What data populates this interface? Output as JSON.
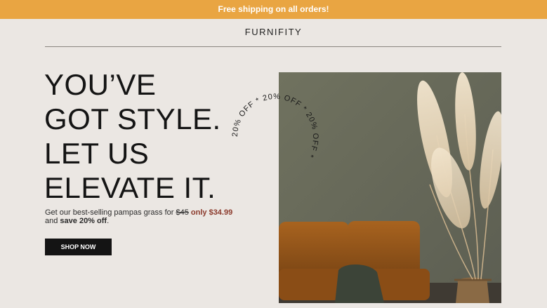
{
  "banner": {
    "text": "Free shipping on all orders!"
  },
  "brand": {
    "logo": "FURNIFITY"
  },
  "hero": {
    "headline_lines": [
      "YOU’VE",
      "GOT STYLE.",
      "LET US",
      "ELEVATE IT."
    ],
    "promo": {
      "prefix": "Get our best-selling pampas grass for ",
      "old_price": "$45",
      "new_price": "only $34.99",
      "line2_prefix": "and ",
      "save_text": "save 20% off",
      "suffix": "."
    },
    "cta_label": "SHOP NOW",
    "badge_text": "20% OFF * 20% OFF * 20% OFF * "
  },
  "colors": {
    "banner": "#e9a542",
    "background": "#ebe7e3",
    "price": "#8b3a2c",
    "button": "#141414"
  }
}
